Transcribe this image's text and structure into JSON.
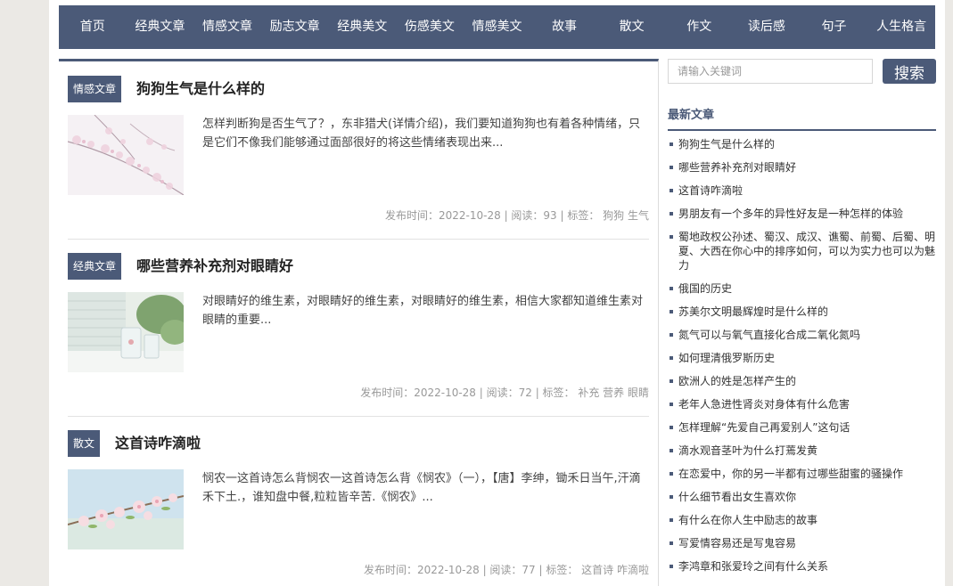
{
  "nav": [
    "首页",
    "经典文章",
    "情感文章",
    "励志文章",
    "经典美文",
    "伤感美文",
    "情感美文",
    "故事",
    "散文",
    "作文",
    "读后感",
    "句子",
    "人生格言"
  ],
  "articles": [
    {
      "category": "情感文章",
      "title": "狗狗生气是什么样的",
      "excerpt": "怎样判断狗是否生气了？，东非猎犬(详情介绍)，我们要知道狗狗也有着各种情绪，只是它们不像我们能够通过面部很好的将这些情绪表现出来...",
      "meta": "发布时间：2022-10-28 | 阅读：93 | 标签： 狗狗 生气",
      "thumb": "cherry-blossom-branch"
    },
    {
      "category": "经典文章",
      "title": "哪些营养补充剂对眼睛好",
      "excerpt": "对眼睛好的维生素，对眼睛好的维生素，对眼睛好的维生素，相信大家都知道维生素对眼睛的重要...",
      "meta": "发布时间：2022-10-28 | 阅读：72 | 标签： 补充 营养 眼睛",
      "thumb": "window-glass-plant"
    },
    {
      "category": "散文",
      "title": "这首诗咋滴啦",
      "excerpt": "悯农一这首诗怎么背悯农一这首诗怎么背《悯农》（一），【唐】李绅，锄禾日当午,汗滴禾下土.，谁知盘中餐,粒粒皆辛苦.《悯农》...",
      "meta": "发布时间：2022-10-28 | 阅读：77 | 标签： 这首诗 咋滴啦",
      "thumb": "peach-blossom-sky"
    }
  ],
  "search": {
    "placeholder": "请输入关键词",
    "button": "搜索"
  },
  "sidebar": {
    "heading": "最新文章",
    "items": [
      "狗狗生气是什么样的",
      "哪些营养补充剂对眼睛好",
      "这首诗咋滴啦",
      "男朋友有一个多年的异性好友是一种怎样的体验",
      "蜀地政权公孙述、蜀汉、成汉、谯蜀、前蜀、后蜀、明夏、大西在你心中的排序如何，可以为实力也可以为魅力",
      "俄国的历史",
      "苏美尔文明最辉煌时是什么样的",
      "氮气可以与氧气直接化合成二氧化氮吗",
      "如何理清俄罗斯历史",
      "欧洲人的姓是怎样产生的",
      "老年人急进性肾炎对身体有什么危害",
      "怎样理解“先爱自己再爱别人”这句话",
      "滴水观音茎叶为什么打蔫发黄",
      "在恋爱中，你的另一半都有过哪些甜蜜的骚操作",
      "什么细节看出女生喜欢你",
      "有什么在你人生中励志的故事",
      "写爱情容易还是写鬼容易",
      "李鸿章和张爱玲之间有什么关系"
    ]
  },
  "colors": {
    "accent": "#4b5a78",
    "page_bg": "#ebe9e5"
  }
}
